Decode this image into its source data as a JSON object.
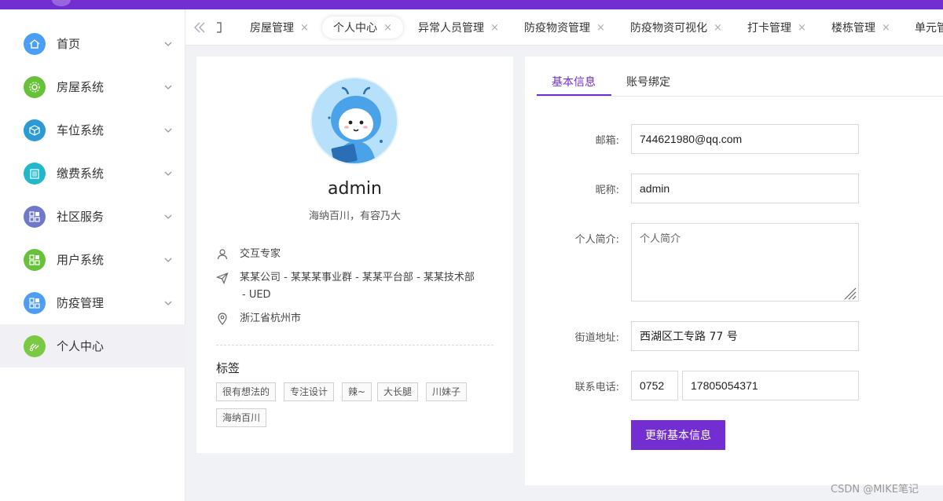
{
  "sidebar": {
    "items": [
      {
        "label": "首页",
        "icon": "home-icon",
        "color": "#4c9ef5"
      },
      {
        "label": "房屋系统",
        "icon": "gear-icon",
        "color": "#67c23a"
      },
      {
        "label": "车位系统",
        "icon": "cube-icon",
        "color": "#2d9ad6"
      },
      {
        "label": "缴费系统",
        "icon": "building-icon",
        "color": "#21b8c9"
      },
      {
        "label": "社区服务",
        "icon": "grid-icon",
        "color": "#6f78c9"
      },
      {
        "label": "用户系统",
        "icon": "grid-icon",
        "color": "#67c23a"
      },
      {
        "label": "防疫管理",
        "icon": "grid-icon",
        "color": "#4c9ef5"
      },
      {
        "label": "个人中心",
        "icon": "user-link-icon",
        "color": "#7ac943",
        "active": true
      }
    ]
  },
  "tabs": [
    {
      "label": "房屋管理"
    },
    {
      "label": "个人中心",
      "active": true
    },
    {
      "label": "异常人员管理"
    },
    {
      "label": "防疫物资管理"
    },
    {
      "label": "防疫物资可视化"
    },
    {
      "label": "打卡管理"
    },
    {
      "label": "楼栋管理"
    },
    {
      "label": "单元管"
    }
  ],
  "profile": {
    "username": "admin",
    "motto": "海纳百川，有容乃大",
    "title": "交互专家",
    "org_line1": "某某公司 - 某某某事业群 - 某某平台部 - 某某技术部",
    "org_line2": "- UED",
    "location": "浙江省杭州市",
    "tags_title": "标签",
    "tags": [
      "很有想法的",
      "专注设计",
      "辣~",
      "大长腿",
      "川妹子",
      "海纳百川"
    ]
  },
  "form": {
    "tabs": [
      "基本信息",
      "账号绑定"
    ],
    "email_label": "邮箱:",
    "email_value": "744621980@qq.com",
    "nickname_label": "昵称:",
    "nickname_value": "admin",
    "bio_label": "个人简介:",
    "bio_placeholder": "个人简介",
    "address_label": "街道地址:",
    "address_value": "西湖区工专路 77 号",
    "phone_label": "联系电话:",
    "phone_area": "0752",
    "phone_number": "17805054371",
    "submit_label": "更新基本信息"
  },
  "watermark": "CSDN @MIKE笔记",
  "colors": {
    "accent": "#722ed1"
  }
}
